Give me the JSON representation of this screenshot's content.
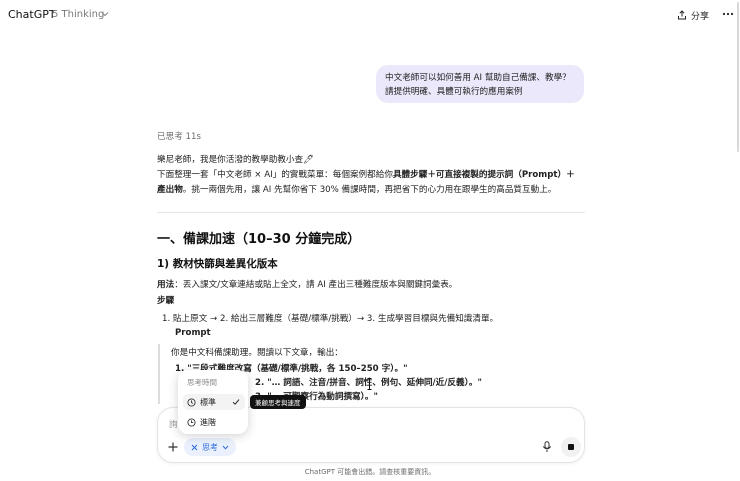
{
  "header": {
    "app_title": "ChatGPT",
    "model_name": "5 Thinking",
    "share_label": "分享"
  },
  "user_message": {
    "line1": "中文老師可以如何善用 AI 幫助自己備課、教學？",
    "line2": "請提供明確、具體可執行的應用案例"
  },
  "assistant": {
    "thought_label": "已思考 11s",
    "intro_line1": "樂尼老師，我是你活潑的教學助教小查🖊",
    "intro_line2_a": "下面整理一套「中文老師 × AI」的實戰菜單：每個案例都給你",
    "intro_line2_b": "具體步驟＋可直接複製的提示詞（Prompt）＋",
    "intro_line3_a": "產出物",
    "intro_line3_b": "。挑一兩個先用，讓 AI 先幫你省下 30% 備課時間，再把省下的心力用在跟學生的高品質互動上。",
    "section_h1": "一、備課加速（10–30 分鐘完成）",
    "section_h3": "1) 教材快篩與差異化版本",
    "usage_label": "用法",
    "usage_text": "：丟入課文/文章連結或貼上全文，請 AI 產出三種難度版本與關鍵詞彙表。",
    "steps_label": "步驟",
    "step1": "1.  貼上原文 → 2. 給出三層難度（基礎/標準/挑戰）→ 3. 生成學習目標與先備知識清單。",
    "prompt_label": "Prompt",
    "prompt_intro": "你是中文科備課助理。閱讀以下文章，輸出：",
    "prompt_item1": "1.  \"三段式難度改寫（基礎/標準/挑戰，各 150–250 字）。\"",
    "prompt_item2": "2.  \"… 詞語、注音/拼音、詞性、例句、延伸同/近/反義）。\"",
    "prompt_item3": "3.  \"… 可觀察行為動詞撰寫）。\""
  },
  "popover": {
    "header": "思考時間",
    "option_standard": "標準",
    "option_advanced": "進階",
    "tooltip": "兼顧思考與速度"
  },
  "composer": {
    "placeholder": "詢",
    "think_chip_label": "思考"
  },
  "footer": {
    "note": "ChatGPT 可能會出錯。請查核重要資訊。"
  }
}
